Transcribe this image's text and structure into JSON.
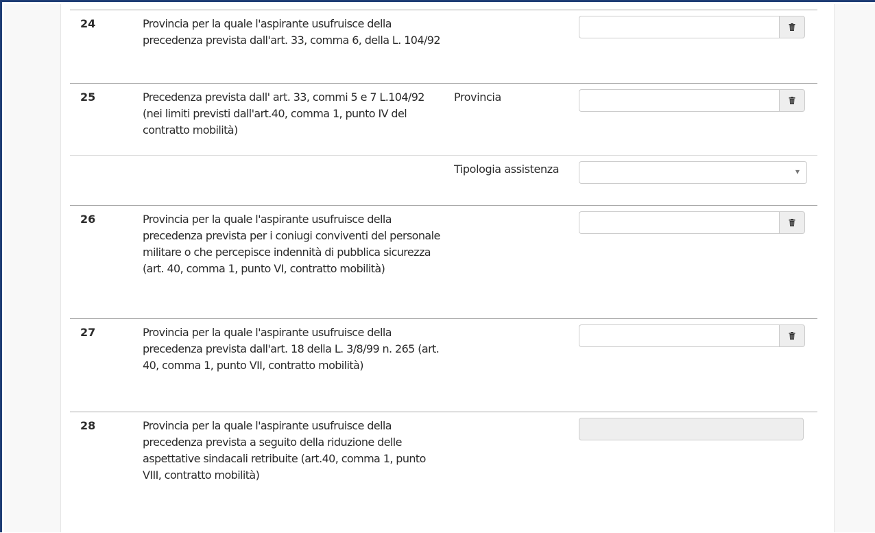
{
  "rows": [
    {
      "number": "24",
      "description": "Provincia per la quale l'aspirante usufruisce della precedenza prevista dall'art. 33, comma 6, della L. 104/92"
    },
    {
      "number": "25",
      "description": "Precedenza prevista dall' art. 33, commi 5 e 7 L.104/92 (nei limiti previsti dall'art.40, comma 1, punto IV del contratto mobilità)",
      "field_label": "Provincia"
    },
    {
      "field_label": "Tipologia assistenza"
    },
    {
      "number": "26",
      "description": "Provincia per la quale l'aspirante usufruisce della precedenza prevista per i coniugi conviventi del personale militare o che percepisce indennità di pubblica sicurezza (art. 40, comma 1, punto VI, contratto mobilità)"
    },
    {
      "number": "27",
      "description": "Provincia per la quale l'aspirante usufruisce della precedenza prevista dall'art. 18 della L. 3/8/99 n. 265 (art. 40, comma 1, punto VII, contratto mobilità)"
    },
    {
      "number": "28",
      "description": "Provincia per la quale l'aspirante usufruisce della precedenza prevista a seguito della riduzione delle aspettative sindacali retribuite (art.40, comma 1, punto VIII, contratto mobilità)"
    }
  ],
  "inputs": {
    "provincia_24": "",
    "provincia_25": "",
    "tipologia_assistenza_selected": "",
    "provincia_26": "",
    "provincia_27": "",
    "provincia_28": ""
  },
  "icons": {
    "clear": "trash-icon",
    "dropdown": "caret-down-icon"
  },
  "colors": {
    "frame_border": "#1f3d75",
    "row_divider": "#a9a9a9",
    "addon_bg": "#eeeeee",
    "disabled_bg": "#eeeeee",
    "text": "#2b2b2b"
  }
}
